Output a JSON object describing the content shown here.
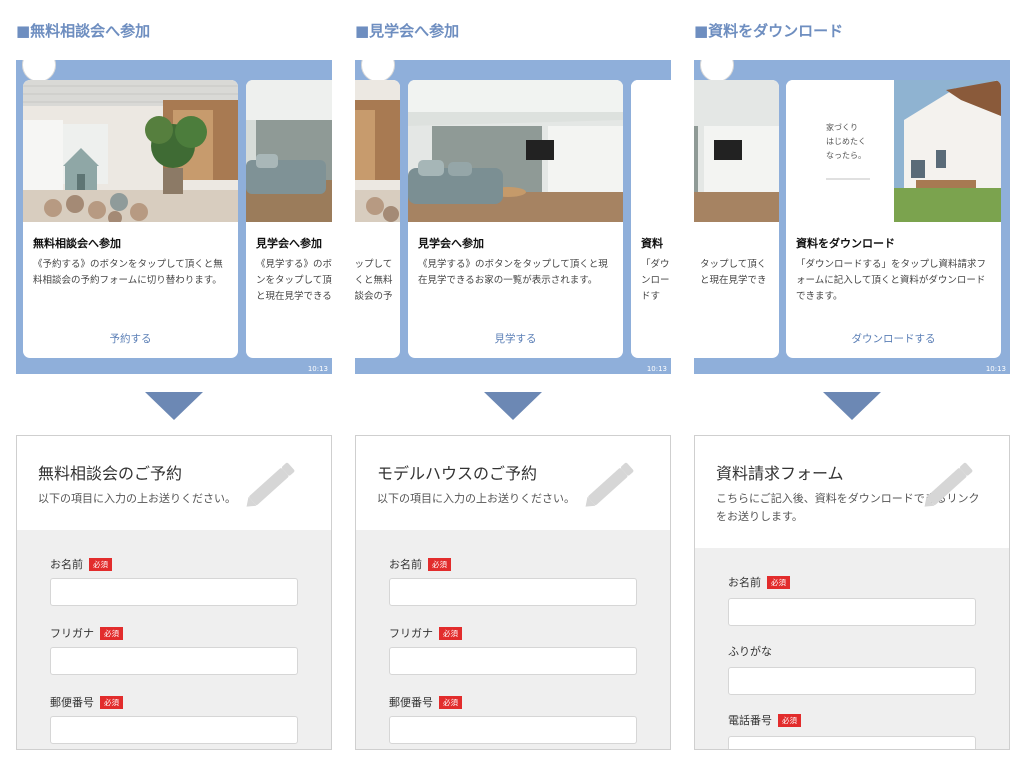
{
  "columns": [
    {
      "heading": "■無料相談会へ参加",
      "phone": {
        "time": "10:13",
        "cards": [
          {
            "title": "無料相談会へ参加",
            "body": "《予約する》のボタンをタップして頂くと無料相談会の予約フォームに切り替わります。",
            "link": "予約する"
          },
          {
            "title": "見学会へ参加",
            "body": "《見学する》のボタンをタップして頂くと現在見学できるお家の一覧が表示されます。"
          }
        ]
      },
      "form": {
        "title": "無料相談会のご予約",
        "subtitle": "以下の項目に入力の上お送りください。",
        "fields": [
          {
            "label": "お名前",
            "required": "必須"
          },
          {
            "label": "フリガナ",
            "required": "必須"
          },
          {
            "label": "郵便番号",
            "required": "必須"
          }
        ]
      }
    },
    {
      "heading": "■見学会へ参加",
      "phone": {
        "time": "10:13",
        "cards": [
          {
            "title": "",
            "body": "タップして頂くと無料相談会の予約フォームに切り替わります。"
          },
          {
            "title": "見学会へ参加",
            "body": "《見学する》のボタンをタップして頂くと現在見学できるお家の一覧が表示されます。",
            "link": "見学する"
          },
          {
            "title": "資料",
            "body": "「ダウンロードする」をタップし資料請求フォームに記入して頂くと資料がダウンロードできます。"
          }
        ]
      },
      "form": {
        "title": "モデルハウスのご予約",
        "subtitle": "以下の項目に入力の上お送りください。",
        "fields": [
          {
            "label": "お名前",
            "required": "必須"
          },
          {
            "label": "フリガナ",
            "required": "必須"
          },
          {
            "label": "郵便番号",
            "required": "必須"
          }
        ]
      }
    },
    {
      "heading": "■資料をダウンロード",
      "phone": {
        "time": "10:13",
        "cards": [
          {
            "title": "",
            "body": "タップして頂くと現在見学できるお家の一覧が表示されます。"
          },
          {
            "title": "資料をダウンロード",
            "body": "「ダウンロードする」をタップし資料請求フォームに記入して頂くと資料がダウンロードできます。",
            "link": "ダウンロードする",
            "brochure_text": "家づくり\nはじめたく\nなったら。"
          }
        ]
      },
      "form": {
        "title": "資料請求フォーム",
        "subtitle": "こちらにご記入後、資料をダウンロードできるリンクをお送りします。",
        "fields": [
          {
            "label": "お名前",
            "required": "必須"
          },
          {
            "label": "ふりがな",
            "required": ""
          },
          {
            "label": "電話番号",
            "required": "必須"
          }
        ]
      }
    }
  ]
}
